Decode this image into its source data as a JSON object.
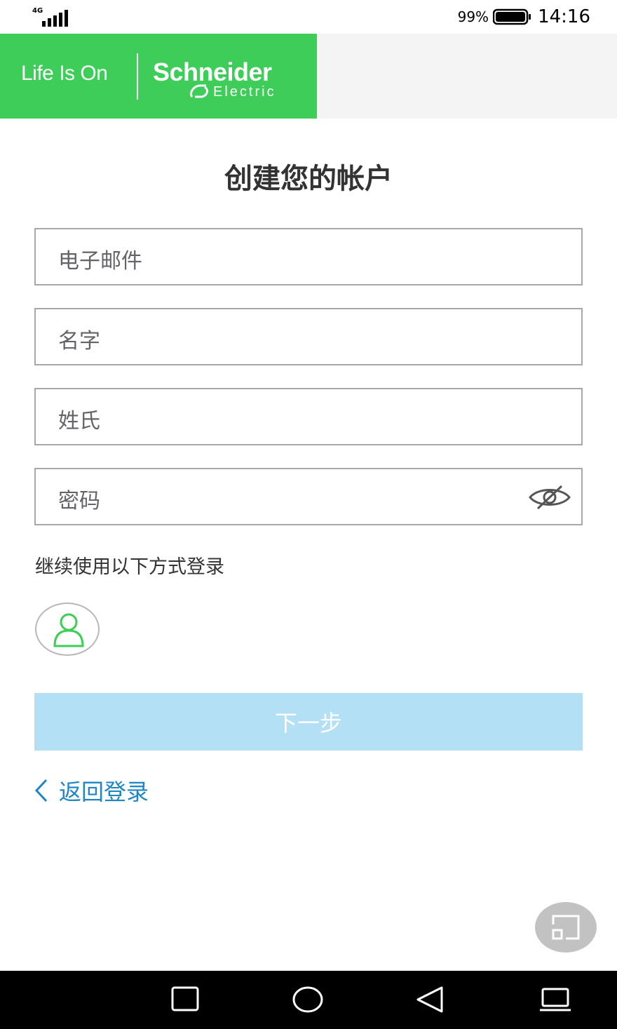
{
  "status_bar": {
    "network": "4G",
    "battery": "99%",
    "time": "14:16"
  },
  "header": {
    "tagline": "Life Is On",
    "brand_name": "Schneider",
    "brand_sub": "Electric",
    "brand_color": "#3dcd58"
  },
  "page": {
    "title": "创建您的帐户"
  },
  "form": {
    "email_placeholder": "电子邮件",
    "first_name_placeholder": "名字",
    "last_name_placeholder": "姓氏",
    "password_placeholder": "密码"
  },
  "social": {
    "label": "继续使用以下方式登录",
    "icon": "user-account-icon"
  },
  "actions": {
    "next_label": "下一步",
    "back_label": "返回登录",
    "button_color": "#b3e0f4",
    "link_color": "#1f86c6"
  },
  "nav": {
    "recent": "square-icon",
    "home": "circle-icon",
    "back": "triangle-back-icon",
    "extra": "laptop-icon"
  }
}
